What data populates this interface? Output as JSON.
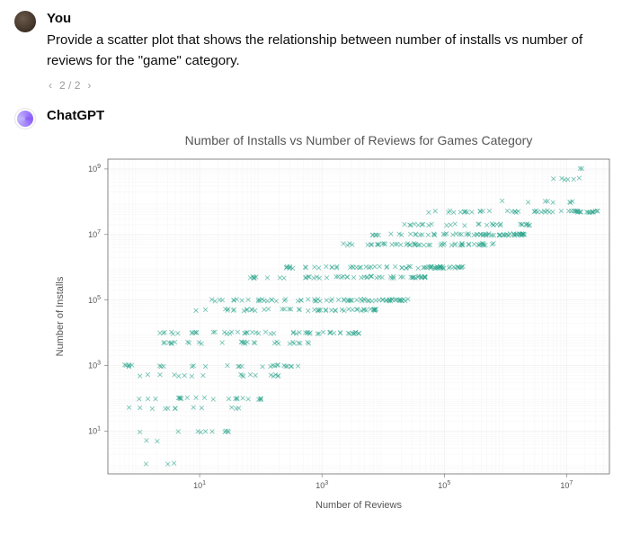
{
  "user": {
    "author": "You",
    "text": "Provide a scatter plot that shows the relationship between number of installs vs number of reviews for the \"game\" category.",
    "pager": {
      "current": 2,
      "total": 2
    }
  },
  "assistant": {
    "author": "ChatGPT"
  },
  "chart_data": {
    "type": "scatter",
    "title": "Number of Installs vs Number of Reviews for Games Category",
    "xlabel": "Number of Reviews",
    "ylabel": "Number of Installs",
    "x_scale": "log",
    "y_scale": "log",
    "xlim_log10": [
      -0.5,
      7.7
    ],
    "ylim_log10": [
      -0.3,
      9.3
    ],
    "x_ticks_log10": [
      1,
      3,
      5,
      7
    ],
    "y_ticks_log10": [
      1,
      3,
      5,
      7,
      9
    ],
    "x_tick_labels": [
      "10^1",
      "10^3",
      "10^5",
      "10^7"
    ],
    "y_tick_labels": [
      "10^1",
      "10^3",
      "10^5",
      "10^7",
      "10^9"
    ],
    "grid": true,
    "bands": [
      {
        "installs_log10": 0.0,
        "x_range_log10": [
          0.0,
          0.6
        ],
        "n": 3
      },
      {
        "installs_log10": 0.7,
        "x_range_log10": [
          0.1,
          0.4
        ],
        "n": 2
      },
      {
        "installs_log10": 1.0,
        "x_range_log10": [
          -0.3,
          1.5
        ],
        "n": 10
      },
      {
        "installs_log10": 1.7,
        "x_range_log10": [
          -0.3,
          1.7
        ],
        "n": 12
      },
      {
        "installs_log10": 2.0,
        "x_range_log10": [
          -0.3,
          2.0
        ],
        "n": 22
      },
      {
        "installs_log10": 2.7,
        "x_range_log10": [
          0.0,
          2.3
        ],
        "n": 18
      },
      {
        "installs_log10": 3.0,
        "x_range_log10": [
          -0.3,
          2.6
        ],
        "n": 28
      },
      {
        "installs_log10": 3.7,
        "x_range_log10": [
          0.3,
          2.8
        ],
        "n": 30
      },
      {
        "installs_log10": 4.0,
        "x_range_log10": [
          0.3,
          3.6
        ],
        "n": 55
      },
      {
        "installs_log10": 4.7,
        "x_range_log10": [
          0.8,
          3.9
        ],
        "n": 50
      },
      {
        "installs_log10": 5.0,
        "x_range_log10": [
          1.2,
          4.4
        ],
        "n": 70
      },
      {
        "installs_log10": 5.7,
        "x_range_log10": [
          1.8,
          4.7
        ],
        "n": 55
      },
      {
        "installs_log10": 6.0,
        "x_range_log10": [
          2.4,
          5.3
        ],
        "n": 70
      },
      {
        "installs_log10": 6.7,
        "x_range_log10": [
          3.3,
          5.8
        ],
        "n": 55
      },
      {
        "installs_log10": 7.0,
        "x_range_log10": [
          3.8,
          6.3
        ],
        "n": 70
      },
      {
        "installs_log10": 7.3,
        "x_range_log10": [
          4.3,
          6.4
        ],
        "n": 30
      },
      {
        "installs_log10": 7.7,
        "x_range_log10": [
          4.7,
          7.5
        ],
        "n": 55
      },
      {
        "installs_log10": 8.0,
        "x_range_log10": [
          5.6,
          7.1
        ],
        "n": 8
      },
      {
        "installs_log10": 8.7,
        "x_range_log10": [
          6.5,
          7.2
        ],
        "n": 6
      },
      {
        "installs_log10": 9.0,
        "x_range_log10": [
          7.2,
          7.3
        ],
        "n": 2
      }
    ]
  }
}
